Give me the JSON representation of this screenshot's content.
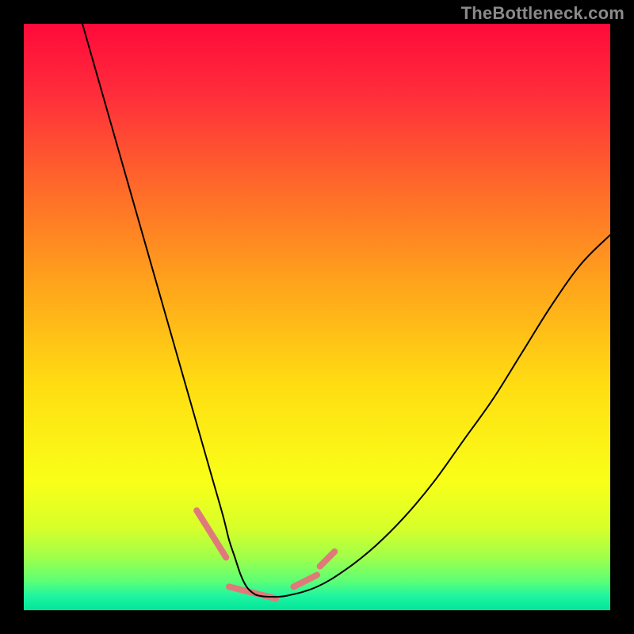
{
  "watermark": "TheBottleneck.com",
  "chart_data": {
    "type": "line",
    "title": "",
    "xlabel": "",
    "ylabel": "",
    "xlim": [
      0,
      100
    ],
    "ylim": [
      0,
      100
    ],
    "grid": false,
    "legend": false,
    "gradient_stops": [
      {
        "offset": 0.0,
        "color": "#ff0a3a"
      },
      {
        "offset": 0.12,
        "color": "#ff2d3b"
      },
      {
        "offset": 0.28,
        "color": "#ff6a2a"
      },
      {
        "offset": 0.45,
        "color": "#ffa61b"
      },
      {
        "offset": 0.62,
        "color": "#ffde12"
      },
      {
        "offset": 0.78,
        "color": "#f9ff18"
      },
      {
        "offset": 0.86,
        "color": "#d7ff2a"
      },
      {
        "offset": 0.91,
        "color": "#9fff4a"
      },
      {
        "offset": 0.95,
        "color": "#5dff75"
      },
      {
        "offset": 0.975,
        "color": "#20f5a0"
      },
      {
        "offset": 1.0,
        "color": "#00e59a"
      }
    ],
    "series": [
      {
        "name": "bottleneck-curve",
        "color": "#000000",
        "stroke_width": 2,
        "x": [
          10,
          12,
          14,
          16,
          18,
          20,
          22,
          24,
          26,
          28,
          30,
          32,
          34,
          35,
          36,
          37,
          38,
          39,
          40,
          42,
          45,
          50,
          55,
          60,
          65,
          70,
          75,
          80,
          85,
          90,
          95,
          100
        ],
        "y": [
          100,
          93,
          86,
          79,
          72,
          65,
          58,
          51,
          44,
          37,
          30,
          23,
          16,
          12,
          9,
          6,
          4,
          3,
          2.5,
          2.3,
          2.5,
          4,
          7,
          11,
          16,
          22,
          29,
          36,
          44,
          52,
          59,
          64
        ]
      }
    ],
    "dash_segments": [
      {
        "x": [
          29.5,
          34.5
        ],
        "y": [
          17,
          9
        ],
        "color": "#e07a7a",
        "stroke_width": 8
      },
      {
        "x": [
          35,
          43
        ],
        "y": [
          4,
          2
        ],
        "color": "#e07a7a",
        "stroke_width": 8
      },
      {
        "x": [
          46,
          50
        ],
        "y": [
          4,
          6
        ],
        "color": "#e07a7a",
        "stroke_width": 8
      },
      {
        "x": [
          50.5,
          53
        ],
        "y": [
          7.5,
          10
        ],
        "color": "#e07a7a",
        "stroke_width": 8
      }
    ]
  }
}
